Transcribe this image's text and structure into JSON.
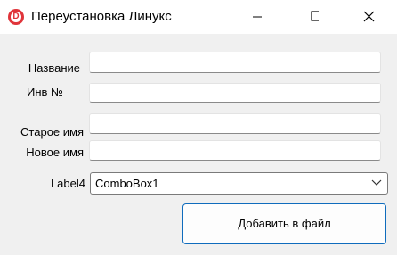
{
  "window": {
    "title": "Переустановка Линукс",
    "icon": "app-d-logo-icon",
    "icon_letter": "D",
    "icon_color": "#e0343a"
  },
  "form": {
    "name_label": "Название",
    "name_value": "",
    "inv_label": "Инв №",
    "inv_value": "",
    "old_name_label": "Старое имя",
    "old_name_value": "",
    "new_name_label": "Новое имя",
    "new_name_value": "",
    "combo_label": "Label4",
    "combo_value": "ComboBox1",
    "add_button_label": "Добавить в файл"
  },
  "colors": {
    "accent": "#0f6cbd",
    "window_bg": "#f0f0f0"
  }
}
